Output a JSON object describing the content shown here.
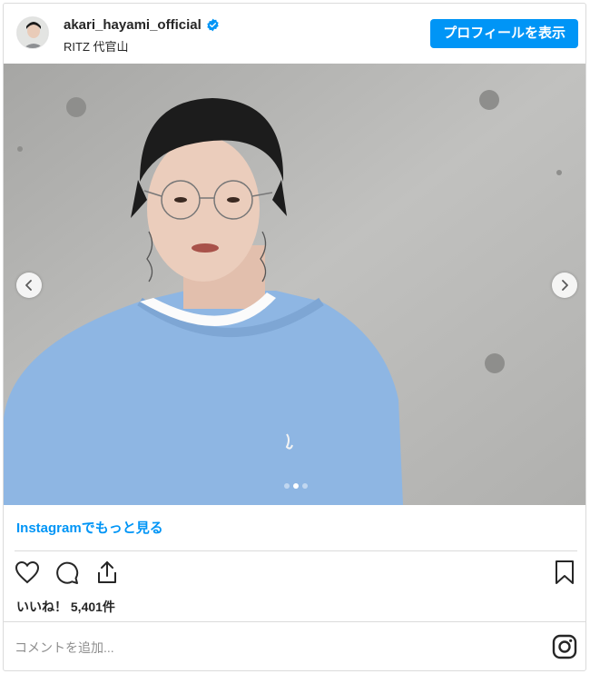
{
  "header": {
    "username": "akari_hayami_official",
    "location": "RITZ 代官山",
    "profile_button": "プロフィールを表示"
  },
  "media": {
    "carousel_total": 3,
    "carousel_active": 2
  },
  "footer": {
    "more_link_brand": "Instagram",
    "more_link_suffix": "でもっと見る",
    "likes_label": "いいね！",
    "likes_count": "5,401件",
    "comment_placeholder": "コメントを追加..."
  },
  "colors": {
    "accent": "#0095f6",
    "text": "#262626",
    "border": "#dbdbdb",
    "sweater": "#8eb6e3",
    "wall": "#b4b4b2"
  },
  "icons": [
    "verified-badge-icon",
    "chevron-left-icon",
    "chevron-right-icon",
    "heart-icon",
    "comment-icon",
    "share-icon",
    "bookmark-icon",
    "instagram-icon"
  ]
}
